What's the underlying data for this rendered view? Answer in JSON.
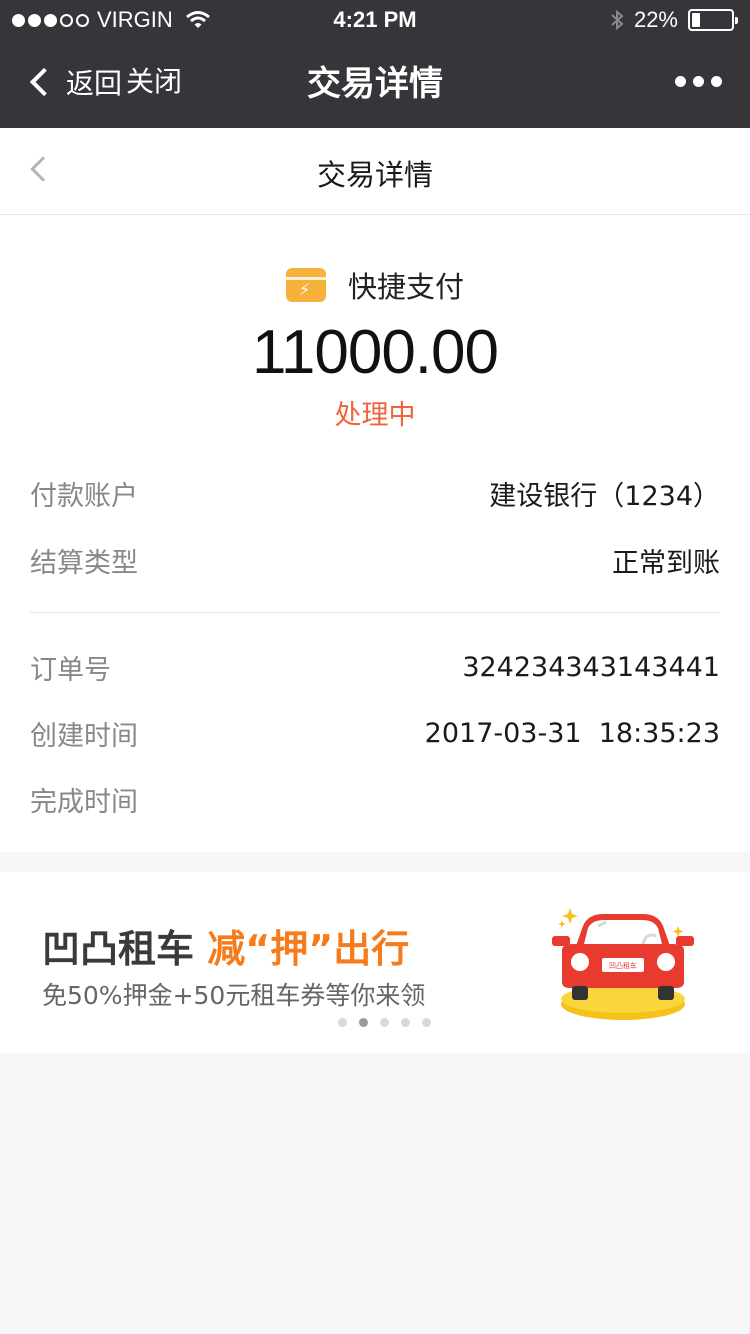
{
  "status_bar": {
    "carrier": "VIRGIN",
    "time": "4:21 PM",
    "battery": "22%",
    "battery_level": 0.22,
    "signal_bars_filled": 3,
    "signal_bars_total": 5
  },
  "nav": {
    "back_label": "返回",
    "close_label": "关闭",
    "title": "交易详情",
    "more_icon": "more-dots-icon"
  },
  "page": {
    "title": "交易详情"
  },
  "payment": {
    "method": "快捷支付",
    "amount": "11000.00",
    "status": "处理中",
    "status_color": "#f0643c"
  },
  "details": {
    "account_label": "付款账户",
    "account_value": "建设银行（1234）",
    "settle_label": "结算类型",
    "settle_value": "正常到账",
    "order_label": "订单号",
    "order_value": "324234343143441",
    "created_label": "创建时间",
    "created_value": "2017-03-31  18:35:23",
    "finished_label": "完成时间",
    "finished_value": ""
  },
  "banner": {
    "brand": "凹凸租车",
    "slogan_a": "减",
    "slogan_b": "“押”",
    "slogan_c": "出行",
    "subtitle": "免50%押金+50元租车券等你来领",
    "dots_total": 5,
    "dots_active_index": 1,
    "accent_color": "#f57b1c",
    "car_plate_text": "凹凸租车"
  }
}
